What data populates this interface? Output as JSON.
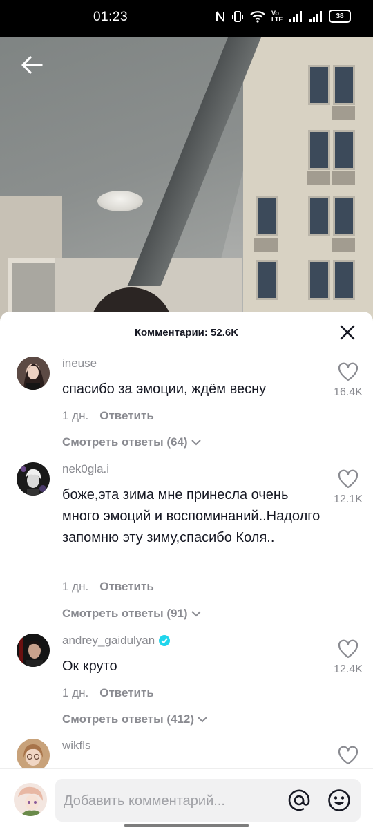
{
  "status_bar": {
    "time": "01:23",
    "battery": "38",
    "network_label": "Vo LTE",
    "icons": [
      "nfc-icon",
      "vibrate-icon",
      "wifi-icon",
      "volte-icon",
      "signal-icon",
      "signal-icon",
      "battery-icon"
    ]
  },
  "video": {
    "back_icon": "arrow-left-icon"
  },
  "comments_panel": {
    "title": "Комментарии: 52.6K",
    "close_icon": "close-icon",
    "comments": [
      {
        "username": "ineuse",
        "verified": false,
        "text": "спасибо за эмоции, ждём весну",
        "time": "1 дн.",
        "reply_label": "Ответить",
        "view_replies": "Смотреть ответы (64)",
        "likes": "16.4K"
      },
      {
        "username": "nek0gla.i",
        "verified": false,
        "text": "боже,эта зима мне принесла очень много эмоций и воспоминаний..Надолго запомню эту зиму,спасибо Коля..",
        "time": "1 дн.",
        "reply_label": "Ответить",
        "view_replies": "Смотреть ответы (91)",
        "likes": "12.1K"
      },
      {
        "username": "andrey_gaidulyan",
        "verified": true,
        "text": "Ок круто",
        "time": "1 дн.",
        "reply_label": "Ответить",
        "view_replies": "Смотреть ответы (412)",
        "likes": "12.4K"
      },
      {
        "username": "wikfls",
        "verified": false,
        "text": "",
        "likes": ""
      }
    ]
  },
  "input_bar": {
    "placeholder": "Добавить комментарий...",
    "at_icon": "at-icon",
    "emoji_icon": "emoji-icon"
  },
  "colors": {
    "text_primary": "#161823",
    "text_secondary": "#8a8b91",
    "verified": "#20d5ec",
    "input_bg": "#f1f1f2"
  }
}
